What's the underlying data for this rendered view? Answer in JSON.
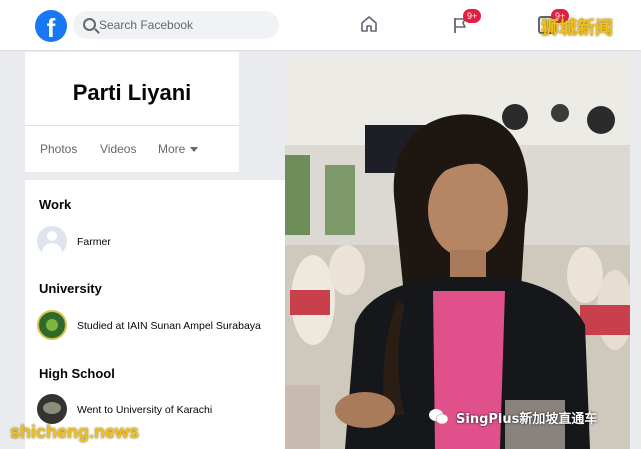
{
  "topbar": {
    "logo_letter": "f",
    "search_placeholder": "Search Facebook",
    "notifications_badge": "9+",
    "messages_badge": "9+",
    "watermark_top": "狮城新闻"
  },
  "profile": {
    "name": "Parti Liyani",
    "tabs": [
      "Photos",
      "Videos",
      "More"
    ]
  },
  "about": {
    "work_title": "Work",
    "work_value": "Farmer",
    "university_title": "University",
    "university_value": "Studied at IAIN Sunan Ampel Surabaya",
    "highschool_title": "High School",
    "highschool_value": "Went to University of Karachi"
  },
  "watermarks": {
    "site": "shicheng.news",
    "channel": "SingPlus新加坡直通车"
  },
  "colors": {
    "facebook_blue": "#1877f2",
    "badge_red": "#e41e3f",
    "watermark_gold": "#f0c11a"
  }
}
